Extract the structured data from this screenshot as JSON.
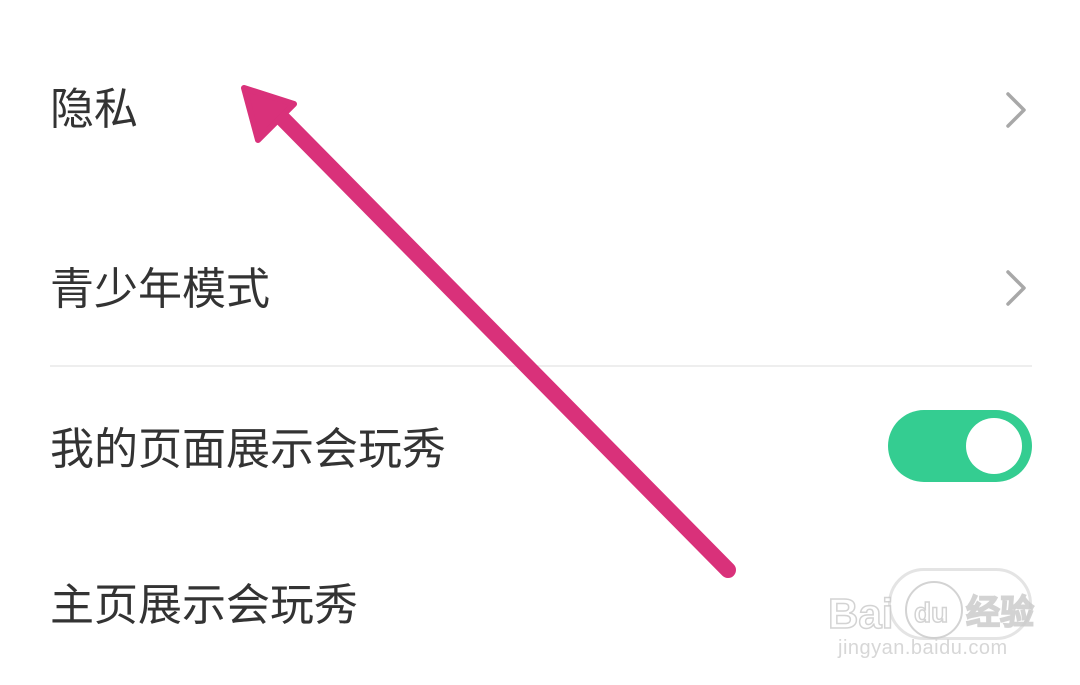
{
  "settings": {
    "items": [
      {
        "label": "隐私",
        "control": "chevron"
      },
      {
        "label": "青少年模式",
        "control": "chevron"
      },
      {
        "label": "我的页面展示会玩秀",
        "control": "toggle",
        "state": "on"
      },
      {
        "label": "主页展示会玩秀",
        "control": "toggle",
        "state": "off"
      }
    ]
  },
  "colors": {
    "toggle_on": "#34cd91",
    "annotation_arrow": "#d9317a",
    "text": "#333333",
    "chevron": "#a8a8a8"
  },
  "watermark": {
    "brand": "Bai du 经验",
    "url": "jingyan.baidu.com"
  }
}
